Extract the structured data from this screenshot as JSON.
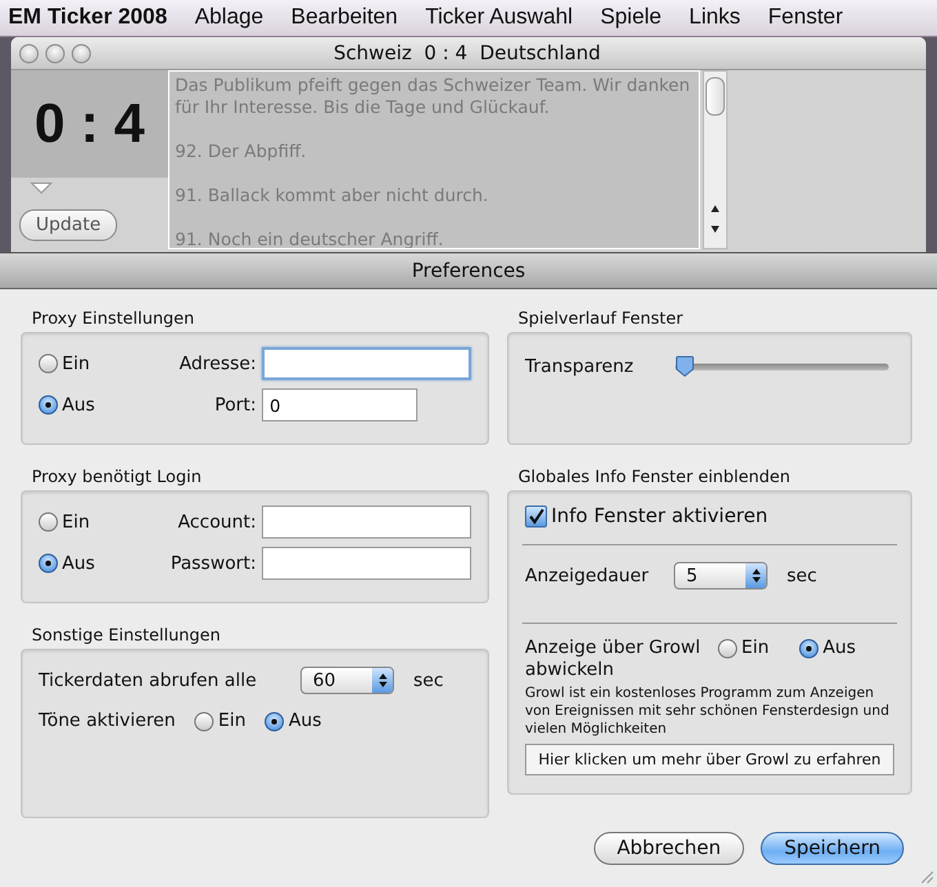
{
  "menubar": {
    "app": "EM Ticker 2008",
    "items": [
      "Ablage",
      "Bearbeiten",
      "Ticker Auswahl",
      "Spiele",
      "Links",
      "Fenster"
    ]
  },
  "ticker_window": {
    "title": "Schweiz  0 : 4  Deutschland",
    "score": "0 : 4",
    "update_button": "Update",
    "feed": [
      "Das Publikum pfeift gegen das Schweizer Team. Wir danken für Ihr Interesse. Bis die Tage und Glückauf.",
      "92. Der Abpfiff.",
      "91. Ballack kommt aber nicht durch.",
      "91. Noch ein deutscher Angriff."
    ]
  },
  "preferences": {
    "title": "Preferences",
    "proxy": {
      "label": "Proxy Einstellungen",
      "options": [
        {
          "label": "Ein",
          "selected": false
        },
        {
          "label": "Aus",
          "selected": true
        }
      ],
      "fields": [
        {
          "label": "Adresse:",
          "focused": true
        },
        {
          "label": "Port:",
          "value": "0",
          "focused": false
        }
      ]
    },
    "login": {
      "label": "Proxy benötigt Login",
      "options": [
        {
          "label": "Ein",
          "selected": false
        },
        {
          "label": "Aus",
          "selected": true
        }
      ],
      "fields": [
        {
          "label": "Account:",
          "focused": false
        },
        {
          "label": "Passwort:",
          "focused": false
        }
      ]
    },
    "other": {
      "label": "Sonstige Einstellungen",
      "interval_label": "Tickerdaten abrufen alle",
      "interval": "60",
      "interval_unit": "sec",
      "sound_label": "Töne aktivieren",
      "sound_options": [
        {
          "label": "Ein",
          "selected": false
        },
        {
          "label": "Aus",
          "selected": true
        }
      ]
    },
    "game_window": {
      "label": "Spielverlauf Fenster",
      "transparency_label": "Transparenz",
      "level": 0.05
    },
    "info": {
      "label": "Globales Info Fenster einblenden",
      "enable_label": "Info Fenster aktivieren",
      "checked": true,
      "duration_label": "Anzeigedauer",
      "duration": "5",
      "duration_unit": "sec",
      "growl_label": "Anzeige über Growl abwickeln",
      "growl_options": [
        {
          "label": "Ein",
          "selected": false
        },
        {
          "label": "Aus",
          "selected": true
        }
      ],
      "growl_description": "Growl ist ein kostenloses Programm zum Anzeigen von Ereignissen mit sehr schönen Fensterdesign und vielen Möglichkeiten",
      "growl_link": "Hier klicken um mehr über Growl zu erfahren"
    },
    "buttons": [
      {
        "label": "Abbrechen",
        "default": false
      },
      {
        "label": "Speichern",
        "default": true
      }
    ]
  }
}
